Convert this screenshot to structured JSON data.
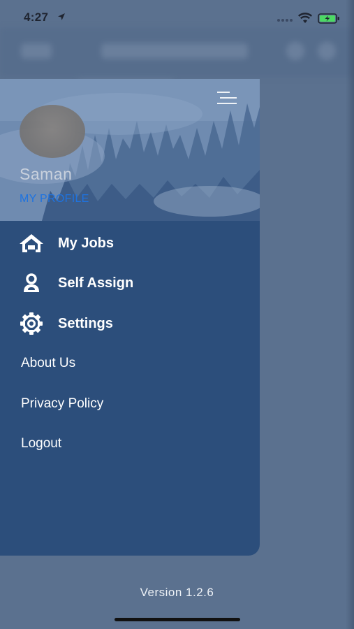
{
  "status_bar": {
    "time": "4:27"
  },
  "drawer": {
    "user_name": "Saman",
    "profile_link": "MY PROFILE",
    "primary_items": [
      {
        "label": "My Jobs",
        "icon": "home-icon"
      },
      {
        "label": "Self Assign",
        "icon": "user-icon"
      },
      {
        "label": "Settings",
        "icon": "gear-icon"
      }
    ],
    "secondary_items": [
      {
        "label": "About Us"
      },
      {
        "label": "Privacy Policy"
      },
      {
        "label": "Logout"
      }
    ]
  },
  "footer": {
    "version": "Version 1.2.6"
  },
  "colors": {
    "drawer_bg": "#2c4e7b",
    "overlay_bg": "#5a708f",
    "link": "#1e73e0",
    "battery": "#4cd964"
  }
}
